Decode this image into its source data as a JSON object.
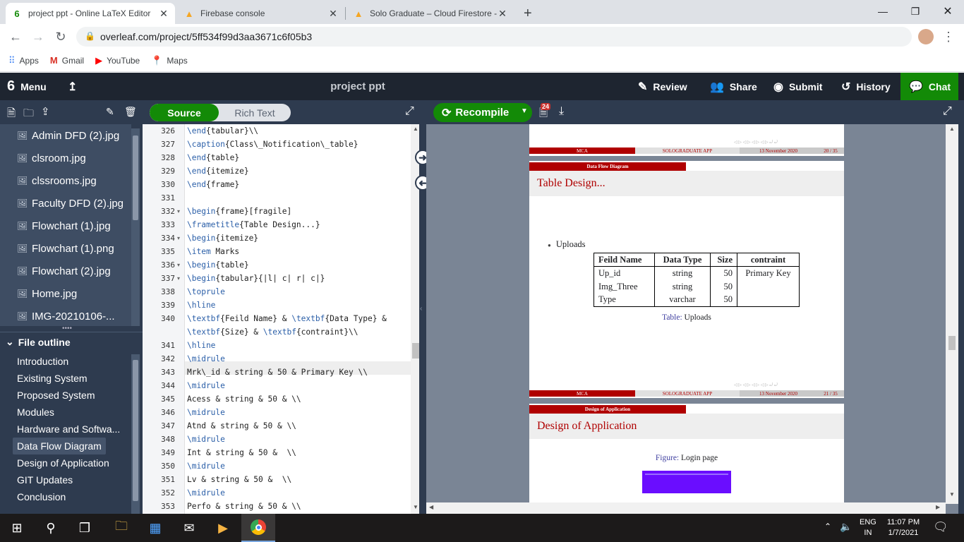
{
  "browser": {
    "tabs": [
      {
        "title": "project ppt - Online LaTeX Editor",
        "active": true
      },
      {
        "title": "Firebase console",
        "active": false
      },
      {
        "title": "Solo Graduate – Cloud Firestore -",
        "active": false
      }
    ],
    "url": "overleaf.com/project/5ff534f99d3aa3671c6f05b3",
    "bookmarks": [
      "Apps",
      "Gmail",
      "YouTube",
      "Maps"
    ]
  },
  "header": {
    "menu_label": "Menu",
    "project_title": "project ppt",
    "review_label": "Review",
    "share_label": "Share",
    "submit_label": "Submit",
    "history_label": "History",
    "chat_label": "Chat"
  },
  "sidebar": {
    "files": [
      "Admin DFD (2).jpg",
      "clsroom.jpg",
      "clssrooms.jpg",
      "Faculty DFD (2).jpg",
      "Flowchart (1).jpg",
      "Flowchart (1).png",
      "Flowchart (2).jpg",
      "Home.jpg",
      "IMG-20210106-..."
    ],
    "outline_title": "File outline",
    "outline": [
      "Introduction",
      "Existing System",
      "Proposed System",
      "Modules",
      "Hardware and Softwa...",
      "Data Flow Diagram",
      "Design of Application",
      "GIT Updates",
      "Conclusion"
    ],
    "selected_outline": "Data Flow Diagram"
  },
  "editor": {
    "mode_source": "Source",
    "mode_rich": "Rich Text",
    "lines": [
      {
        "n": "326",
        "code": "\\end{tabular}\\\\"
      },
      {
        "n": "327",
        "code": "\\caption{Class\\_Notification\\_table}"
      },
      {
        "n": "328",
        "code": "\\end{table}"
      },
      {
        "n": "329",
        "code": "\\end{itemize}"
      },
      {
        "n": "330",
        "code": "\\end{frame}"
      },
      {
        "n": "331",
        "code": ""
      },
      {
        "n": "332",
        "code": "\\begin{frame}[fragile]",
        "fold": true
      },
      {
        "n": "333",
        "code": "\\frametitle{Table Design...}"
      },
      {
        "n": "334",
        "code": "\\begin{itemize}",
        "fold": true
      },
      {
        "n": "335",
        "code": "\\item Marks"
      },
      {
        "n": "336",
        "code": "\\begin{table}",
        "fold": true
      },
      {
        "n": "337",
        "code": "\\begin{tabular}{|l| c| r| c|}",
        "fold": true
      },
      {
        "n": "338",
        "code": "\\toprule"
      },
      {
        "n": "339",
        "code": "\\hline"
      },
      {
        "n": "340",
        "code": "\\textbf{Feild Name} & \\textbf{Data Type} &"
      },
      {
        "n": "",
        "code": "\\textbf{Size} & \\textbf{contraint}\\\\"
      },
      {
        "n": "341",
        "code": "\\hline"
      },
      {
        "n": "342",
        "code": "\\midrule"
      },
      {
        "n": "343",
        "code": "Mrk\\_id & string & 50 & Primary Key \\\\",
        "current": true
      },
      {
        "n": "344",
        "code": "\\midrule"
      },
      {
        "n": "345",
        "code": "Acess & string & 50 & \\\\"
      },
      {
        "n": "346",
        "code": "\\midrule"
      },
      {
        "n": "347",
        "code": "Atnd & string & 50 & \\\\"
      },
      {
        "n": "348",
        "code": "\\midrule"
      },
      {
        "n": "349",
        "code": "Int & string & 50 &  \\\\"
      },
      {
        "n": "350",
        "code": "\\midrule"
      },
      {
        "n": "351",
        "code": "Lv & string & 50 &  \\\\"
      },
      {
        "n": "352",
        "code": "\\midrule"
      },
      {
        "n": "353",
        "code": "Perfo & string & 50 & \\\\"
      }
    ]
  },
  "pdf": {
    "recompile_label": "Recompile",
    "log_badge": "24",
    "page20": {
      "footer": [
        "MCA",
        "SOLOGRADUATE APP",
        "13 November 2020",
        "20 / 35"
      ]
    },
    "page21": {
      "section": "Data Flow Diagram",
      "title": "Table Design...",
      "bullet": "Uploads",
      "table_header": [
        "Feild Name",
        "Data Type",
        "Size",
        "contraint"
      ],
      "table_rows": [
        [
          "Up_id",
          "string",
          "50",
          "Primary Key"
        ],
        [
          "Img_Three",
          "string",
          "50",
          ""
        ],
        [
          "Type",
          "varchar",
          "50",
          ""
        ]
      ],
      "caption_label": "Table:",
      "caption_text": "Uploads",
      "footer": [
        "MCA",
        "SOLOGRADUATE APP",
        "13 November 2020",
        "21 / 35"
      ]
    },
    "page22": {
      "section": "Design of Application",
      "title": "Design of Application",
      "caption_label": "Figure:",
      "caption_text": "Login page"
    }
  },
  "taskbar": {
    "lang": "ENG",
    "region": "IN",
    "time": "11:07 PM",
    "date": "1/7/2021"
  }
}
